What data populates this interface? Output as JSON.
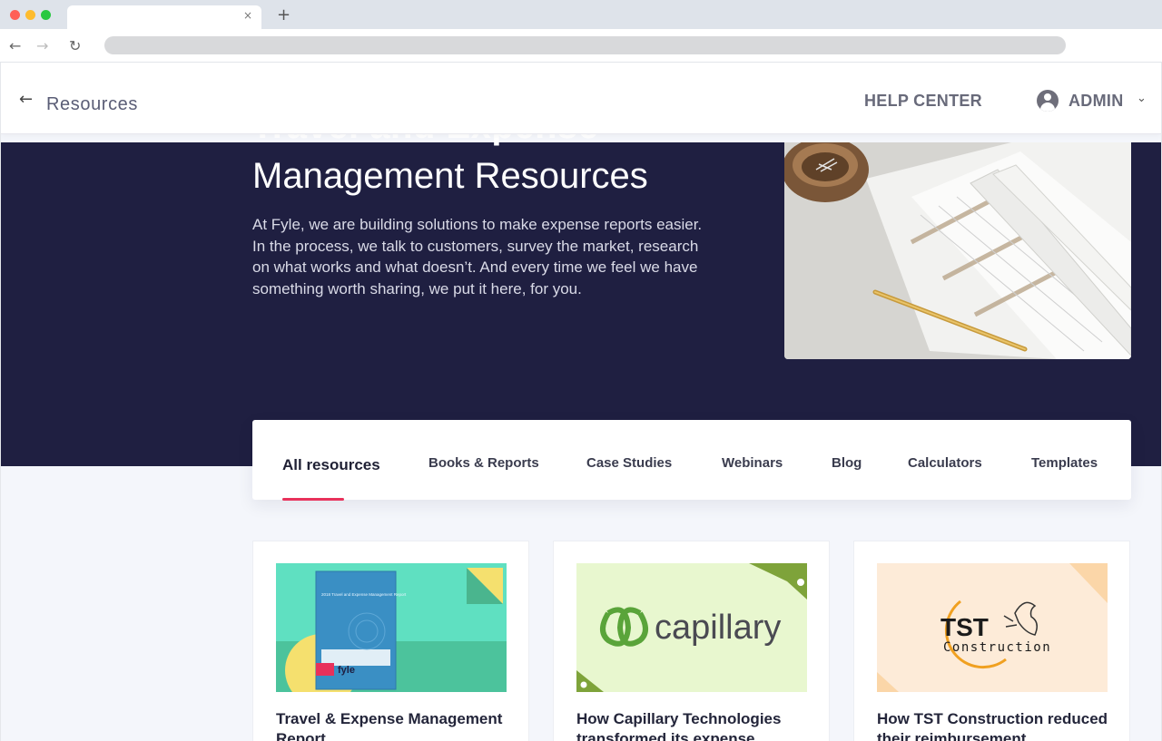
{
  "browser": {
    "tab_close": "×",
    "new_tab": "+",
    "back": "←",
    "forward": "→",
    "reload": "↻"
  },
  "header": {
    "back_icon": "arrow-left-icon",
    "breadcrumb": "Resources",
    "help_center": "HELP CENTER",
    "admin": "ADMIN",
    "admin_chevron": "⌄"
  },
  "hero": {
    "ghost_title": "Travel and Expense",
    "title": "Management Resources",
    "description": "At Fyle, we are building solutions to make expense reports easier. In the process, we talk to customers, survey the market, research on what works and what doesn’t. And every time we feel we have something worth sharing, we put it here, for you."
  },
  "resource_tabs": [
    {
      "label": "All resources",
      "active": true
    },
    {
      "label": "Books & Reports",
      "active": false
    },
    {
      "label": "Case Studies",
      "active": false
    },
    {
      "label": "Webinars",
      "active": false
    },
    {
      "label": "Blog",
      "active": false
    },
    {
      "label": "Calculators",
      "active": false
    },
    {
      "label": "Templates",
      "active": false
    }
  ],
  "cards": [
    {
      "title": "Travel & Expense Management Report",
      "thumb_text": "fyle",
      "thumb_sub": "2018 Travel and Expense Management Report"
    },
    {
      "title": "How Capillary Technologies transformed its expense",
      "thumb_text": "capillary"
    },
    {
      "title": "How TST Construction reduced their reimbursement",
      "thumb_text": "TST",
      "thumb_sub": "Construction"
    }
  ],
  "colors": {
    "hero_bg": "#1f1f41",
    "accent": "#e8315b",
    "card1_bg": "#5fe0c1",
    "card2_bg": "#e8f7cf",
    "card3_bg": "#fdebd8"
  }
}
